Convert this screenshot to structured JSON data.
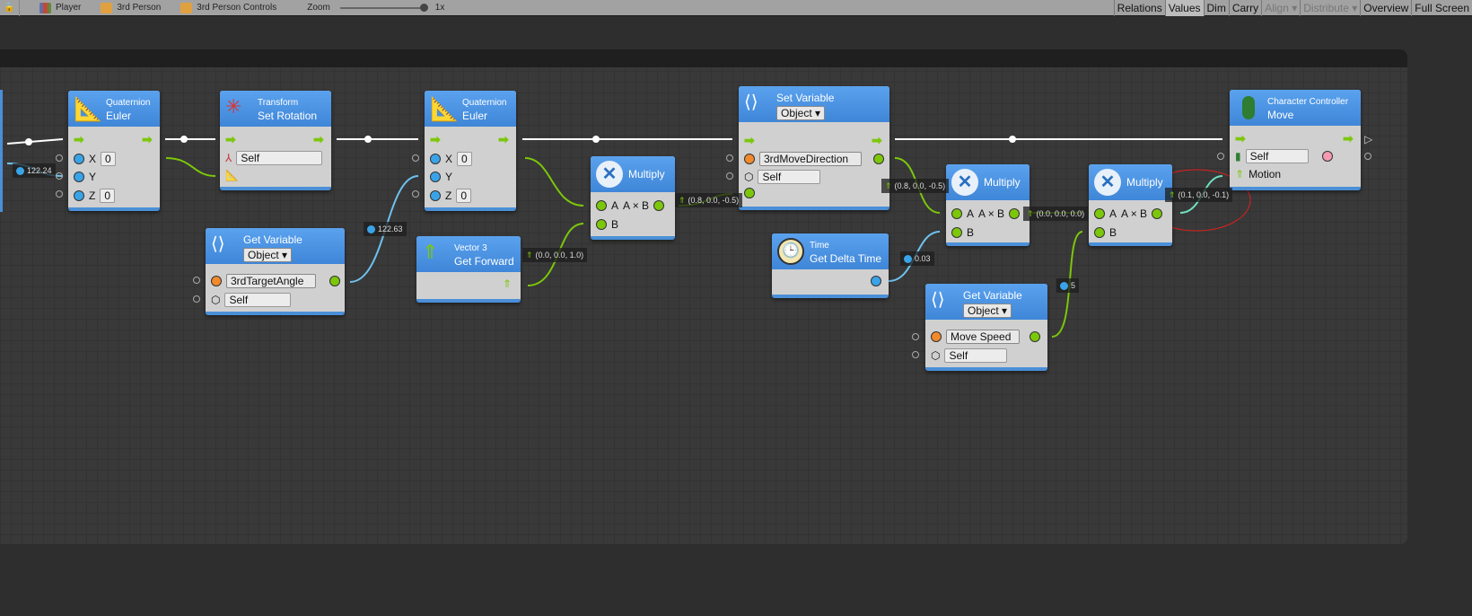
{
  "toolbar": {
    "player": "Player",
    "third_person": "3rd Person",
    "third_person_controls": "3rd Person Controls",
    "zoom_label": "Zoom",
    "zoom_value": "1x",
    "buttons": {
      "relations": "Relations",
      "values": "Values",
      "dim": "Dim",
      "carry": "Carry",
      "align": "Align",
      "distribute": "Distribute",
      "overview": "Overview",
      "full_screen": "Full Screen"
    }
  },
  "nodes": {
    "euler1": {
      "sub": "Quaternion",
      "title": "Euler",
      "x": "X",
      "y": "Y",
      "z": "Z",
      "x_val": "0",
      "z_val": "0"
    },
    "set_rotation": {
      "sub": "Transform",
      "title": "Set Rotation",
      "target": "Self"
    },
    "euler2": {
      "sub": "Quaternion",
      "title": "Euler",
      "x": "X",
      "y": "Y",
      "z": "Z",
      "x_val": "0",
      "z_val": "0"
    },
    "get_var1": {
      "title": "Get Variable",
      "kind": "Object",
      "name": "3rdTargetAngle",
      "target": "Self"
    },
    "get_forward": {
      "sub": "Vector 3",
      "title": "Get Forward"
    },
    "multiply1": {
      "title": "Multiply",
      "a": "A",
      "b": "B",
      "out": "A × B"
    },
    "set_var": {
      "title": "Set Variable",
      "kind": "Object",
      "name": "3rdMoveDirection",
      "target": "Self"
    },
    "delta_time": {
      "sub": "Time",
      "title": "Get Delta Time"
    },
    "multiply2": {
      "title": "Multiply",
      "a": "A",
      "b": "B",
      "out": "A × B"
    },
    "multiply3": {
      "title": "Multiply",
      "a": "A",
      "b": "B",
      "out": "A × B"
    },
    "get_var2": {
      "title": "Get Variable",
      "kind": "Object",
      "name": "Move Speed",
      "target": "Self"
    },
    "move": {
      "sub": "Character Controller",
      "title": "Move",
      "target": "Self",
      "motion": "Motion"
    }
  },
  "values": {
    "v1": "122.24",
    "v2": "122.63",
    "v3": "(0.0, 0.0, 1.0)",
    "v4": "(0.8, 0.0, -0.5)",
    "v5": "(0.8, 0.0, -0.5)",
    "v6": "0.03",
    "v7": "(0.0, 0.0, 0.0)",
    "v8": "5",
    "v9": "(0.1, 0.0, -0.1)"
  },
  "colors": {
    "float": "#3aa3e8",
    "vector": "#7cc70a",
    "accent": "#4a8fd8",
    "annotation": "#e0201e"
  }
}
